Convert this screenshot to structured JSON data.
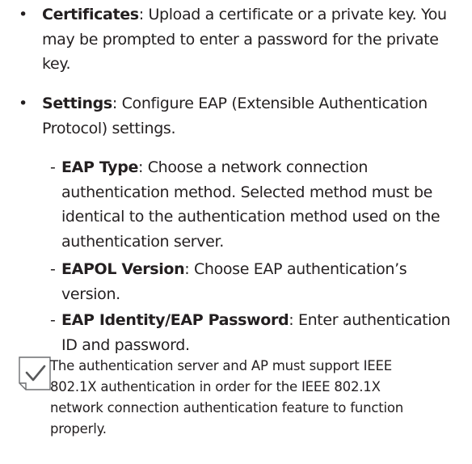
{
  "bullets": [
    {
      "term": "Certificates",
      "text": ": Upload a certificate or a private key. You may be prompted to enter a password for the private key."
    },
    {
      "term": "Settings",
      "text": ": Configure EAP (Extensible Authentication Protocol) settings."
    }
  ],
  "sub_items": [
    {
      "term": "EAP Type",
      "text": ": Choose a network connection authentication method. Selected method must be identical to the authentication method used on the authentication server."
    },
    {
      "term": "EAPOL Version",
      "text": ": Choose EAP authentication’s version."
    },
    {
      "term": "EAP Identity/EAP Password",
      "text": ": Enter authentication ID and password."
    }
  ],
  "note": {
    "icon": "checkmark-note-icon",
    "text": "The authentication server and AP must support IEEE 802.1X authentication in order for the IEEE 802.1X network connection authentication feature to function properly."
  },
  "bullet_symbol": "•",
  "dash_symbol": "-"
}
